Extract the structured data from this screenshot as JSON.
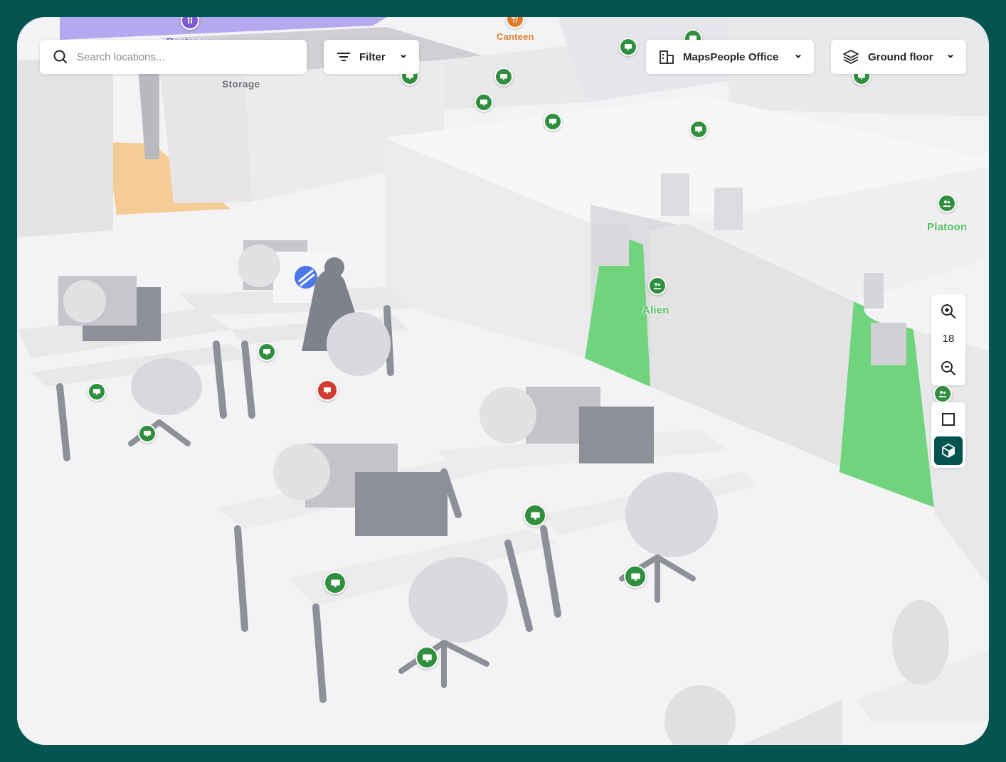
{
  "search": {
    "placeholder": "Search locations..."
  },
  "filter": {
    "label": "Filter"
  },
  "venue": {
    "label": "MapsPeople Office"
  },
  "floor": {
    "label": "Ground floor"
  },
  "zoom": {
    "level": "18"
  },
  "map_labels": {
    "restroom": "Restroom",
    "canteen": "Canteen",
    "storage": "Storage",
    "alien": "Alien",
    "platoon": "Platoon"
  },
  "icons": {
    "search": "search-icon",
    "filter": "filter-icon",
    "venue": "building-icon",
    "floor": "layers-icon",
    "zoom_in": "zoom-in-icon",
    "zoom_out": "zoom-out-icon",
    "view_2d": "square-icon",
    "view_3d": "cube-icon",
    "desk": "monitor-icon",
    "meeting_room": "people-icon"
  },
  "colors": {
    "frame": "#03544f",
    "available_desk": "#2f8f3e",
    "occupied_desk": "#d23b32",
    "meeting_room_highlight": "#6fd47c",
    "restroom_area": "#b4a8ee",
    "canteen_text": "#e07a2c",
    "room_label": "#4cbf5d"
  }
}
